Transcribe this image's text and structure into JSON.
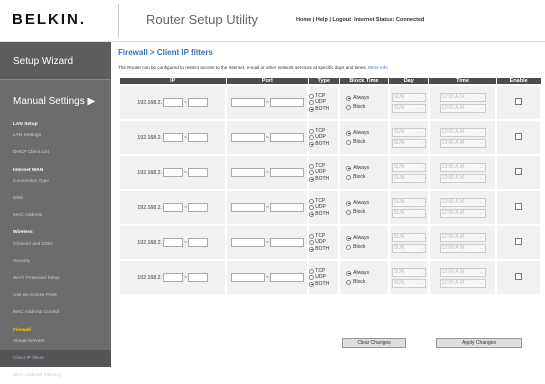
{
  "header": {
    "logo": "BELKIN.",
    "app_title": "Router Setup Utility",
    "links": [
      "Home",
      "Help",
      "Logout"
    ],
    "status": "Internet Status: Connected"
  },
  "sidebar": {
    "wizard": "Setup Wizard",
    "manual": "Manual Settings ▶",
    "groups": [
      {
        "title": "LAN Setup",
        "items": [
          "LAN Settings",
          "DHCP Client List"
        ]
      },
      {
        "title": "Internet WAN",
        "items": [
          "Connection Type",
          "DNS",
          "MAC Address"
        ]
      },
      {
        "title": "Wireless",
        "items": [
          "Channel and SSID",
          "Security",
          "Wi-Fi Protected Setup",
          "Use as Access Point",
          "MAC Address Control"
        ]
      },
      {
        "title": "Firewall",
        "items": [
          "Virtual Servers",
          "Client IP filters",
          "MAC Address Filtering"
        ]
      }
    ]
  },
  "page": {
    "title": "Firewall > Client IP filters",
    "description": "The Router can be configured to restrict access to the Internet, e-mail or other network services at specific days and times.",
    "more": "More Info"
  },
  "table": {
    "headers": [
      "IP",
      "Port",
      "Type",
      "Block Time",
      "Day",
      "Time",
      "Enable"
    ],
    "ip_prefix": "192.168.2.",
    "types": [
      "TCP",
      "UDP",
      "BOTH"
    ],
    "block": [
      "Always",
      "Block"
    ],
    "day": "SUN",
    "time": "12:00 A.M.",
    "row_count": 6
  },
  "buttons": {
    "clear": "Clear Changes",
    "apply": "Apply Changes"
  }
}
